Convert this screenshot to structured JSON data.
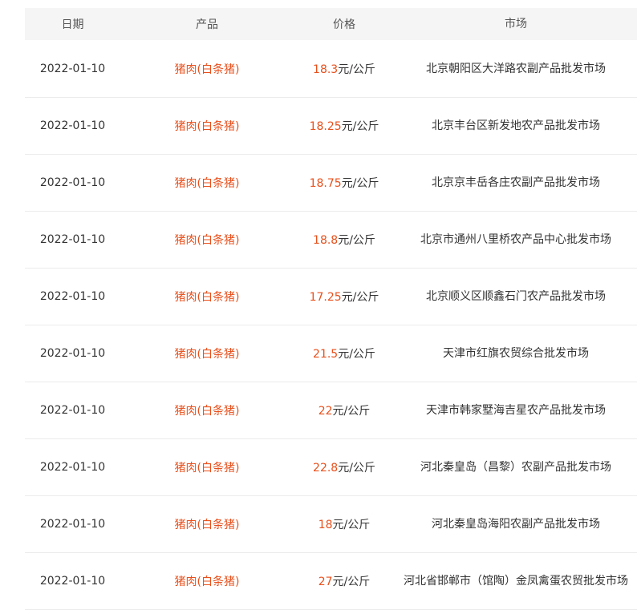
{
  "header": {
    "date": "日期",
    "product": "产品",
    "price": "价格",
    "market": "市场"
  },
  "colors": {
    "accent": "#e8501c",
    "header_bg": "#f5f5f5",
    "divider": "#ebebeb"
  },
  "rows": [
    {
      "date": "2022-01-10",
      "product": "猪肉(白条猪)",
      "price": "18.3",
      "unit": "元/公斤",
      "market": "北京朝阳区大洋路农副产品批发市场"
    },
    {
      "date": "2022-01-10",
      "product": "猪肉(白条猪)",
      "price": "18.25",
      "unit": "元/公斤",
      "market": "北京丰台区新发地农产品批发市场"
    },
    {
      "date": "2022-01-10",
      "product": "猪肉(白条猪)",
      "price": "18.75",
      "unit": "元/公斤",
      "market": "北京京丰岳各庄农副产品批发市场"
    },
    {
      "date": "2022-01-10",
      "product": "猪肉(白条猪)",
      "price": "18.8",
      "unit": "元/公斤",
      "market": "北京市通州八里桥农产品中心批发市场"
    },
    {
      "date": "2022-01-10",
      "product": "猪肉(白条猪)",
      "price": "17.25",
      "unit": "元/公斤",
      "market": "北京顺义区顺鑫石门农产品批发市场"
    },
    {
      "date": "2022-01-10",
      "product": "猪肉(白条猪)",
      "price": "21.5",
      "unit": "元/公斤",
      "market": "天津市红旗农贸综合批发市场"
    },
    {
      "date": "2022-01-10",
      "product": "猪肉(白条猪)",
      "price": "22",
      "unit": "元/公斤",
      "market": "天津市韩家墅海吉星农产品批发市场"
    },
    {
      "date": "2022-01-10",
      "product": "猪肉(白条猪)",
      "price": "22.8",
      "unit": "元/公斤",
      "market": "河北秦皇岛（昌黎）农副产品批发市场"
    },
    {
      "date": "2022-01-10",
      "product": "猪肉(白条猪)",
      "price": "18",
      "unit": "元/公斤",
      "market": "河北秦皇岛海阳农副产品批发市场"
    },
    {
      "date": "2022-01-10",
      "product": "猪肉(白条猪)",
      "price": "27",
      "unit": "元/公斤",
      "market": "河北省邯郸市（馆陶）金凤禽蛋农贸批发市场"
    }
  ]
}
